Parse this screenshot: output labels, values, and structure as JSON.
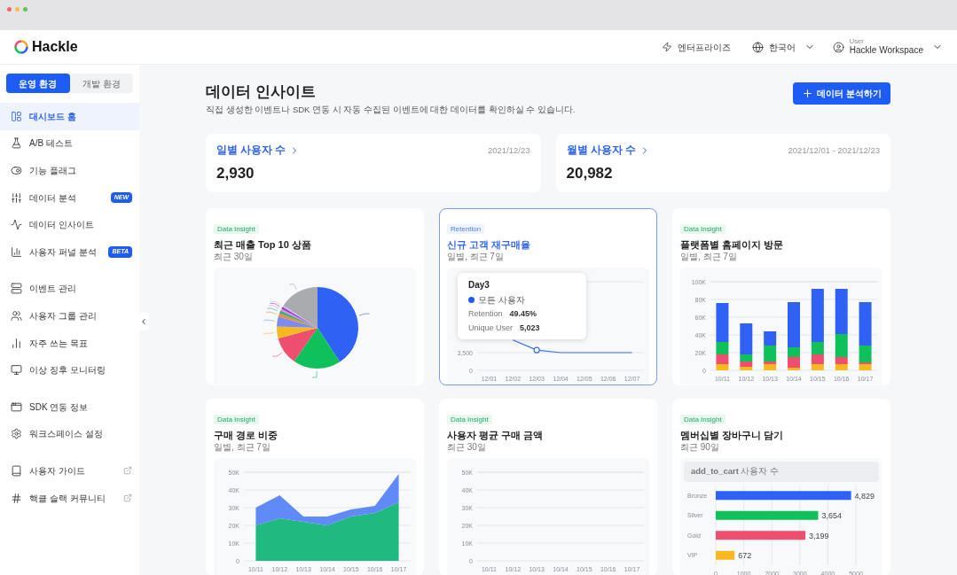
{
  "header": {
    "logo": "Hackle",
    "links": [
      {
        "label": "엔터프라이즈",
        "dropdown": false
      },
      {
        "label": "한국어",
        "dropdown": true
      }
    ],
    "user": {
      "caption": "User",
      "workspace": "Hackle Workspace"
    }
  },
  "env_tabs": [
    {
      "label": "운영 환경",
      "selected": true
    },
    {
      "label": "개발 환경",
      "selected": false
    }
  ],
  "sidebar": {
    "groups": [
      [
        {
          "label": "대시보드 홈",
          "selected": true,
          "external": false
        },
        {
          "label": "A/B 테스트",
          "selected": false,
          "external": false
        },
        {
          "label": "기능 플래그",
          "selected": false,
          "external": false
        },
        {
          "label": "데이터 분석",
          "selected": false,
          "external": false,
          "badge": "NEW"
        },
        {
          "label": "데이터 인사이트",
          "selected": false,
          "external": false
        },
        {
          "label": "사용자 퍼널 분석",
          "selected": false,
          "external": false,
          "badge": "BETA"
        }
      ],
      [
        {
          "label": "이벤트 관리",
          "selected": false,
          "external": false
        },
        {
          "label": "사용자 그룹 관리",
          "selected": false,
          "external": false
        },
        {
          "label": "자주 쓰는 목표",
          "selected": false,
          "external": false
        },
        {
          "label": "이상 징후 모니터링",
          "selected": false,
          "external": false
        }
      ],
      [
        {
          "label": "SDK 연동 정보",
          "selected": false,
          "external": false
        },
        {
          "label": "워크스페이스 설정",
          "selected": false,
          "external": false
        }
      ],
      [
        {
          "label": "사용자 가이드",
          "selected": false,
          "external": true
        },
        {
          "label": "핵클 슬랙 커뮤니티",
          "selected": false,
          "external": true
        }
      ]
    ]
  },
  "page": {
    "title": "데이터 인사이트",
    "subtitle": "직접 생성한 이벤트나 SDK 연동 시 자동 수집된 이벤트에 대한 데이터를 확인하실 수 있습니다.",
    "action": "데이터 분석하기"
  },
  "stats": [
    {
      "label": "일별 사용자 수",
      "date": "2021/12/23",
      "value": "2,930"
    },
    {
      "label": "월별 사용자 수",
      "date": "2021/12/01 - 2021/12/23",
      "value": "20,982"
    }
  ],
  "cards": [
    {
      "kind": "pie",
      "tag": "Data Insight",
      "title": "최근 매출 Top 10 상품",
      "subtitle": "최근 30일",
      "selected": false
    },
    {
      "kind": "retention",
      "tag": "Retention",
      "title": "신규 고객 재구매율",
      "subtitle": "일별, 최근 7일",
      "selected": true,
      "tooltip": {
        "title": "Day3",
        "series": "모든 사용자",
        "rows": [
          {
            "label": "Retention",
            "value": "49.45%"
          },
          {
            "label": "Unique User",
            "value": "5,023"
          }
        ]
      },
      "chart_data": {
        "type": "line",
        "grid": true,
        "categories": [
          "12/01",
          "12/02",
          "12/03",
          "12/04",
          "12/05",
          "12/06",
          "12/07"
        ],
        "ylim": [
          0,
          17500
        ],
        "yticks": [
          0,
          {
            "value": 3500,
            "label": "3,500"
          }
        ],
        "series": [
          {
            "color": "#3b6ef5",
            "values": [
              null,
              6000,
              4000,
              3500,
              3500,
              3500,
              3500
            ]
          }
        ]
      }
    },
    {
      "kind": "vbar",
      "tag": "Data Insight",
      "title": "플랫폼별 홈페이지 방문",
      "subtitle": "일별, 최근 7일",
      "selected": false,
      "chart_data": {
        "type": "bar",
        "stacked": true,
        "grid": true,
        "categories": [
          "10/11",
          "10/12",
          "10/13",
          "10/14",
          "10/15",
          "10/16",
          "10/17"
        ],
        "ylim": [
          0,
          100000
        ],
        "yticks": [
          {
            "value": 0,
            "label": "0"
          },
          {
            "value": 20000,
            "label": "20K"
          },
          {
            "value": 40000,
            "label": "40K"
          },
          {
            "value": 60000,
            "label": "60K"
          },
          {
            "value": 80000,
            "label": "80K"
          },
          {
            "value": 100000,
            "label": "100K"
          }
        ],
        "series": [
          {
            "color": "#f8b820",
            "values": [
              7000,
              4000,
              7000,
              3000,
              7000,
              7000,
              7000
            ]
          },
          {
            "color": "#ef4f6f",
            "values": [
              11000,
              6000,
              3000,
              12000,
              11000,
              8000,
              2000
            ]
          },
          {
            "color": "#0fc15a",
            "values": [
              14000,
              8000,
              18000,
              11000,
              14000,
              26000,
              19000
            ]
          },
          {
            "color": "#2f62f4",
            "values": [
              44000,
              35000,
              16000,
              51000,
              60000,
              51000,
              49000
            ]
          }
        ]
      }
    },
    {
      "kind": "area",
      "tag": "Data Insight",
      "title": "구매 경로 비중",
      "subtitle": "일별, 최근 7일",
      "selected": false,
      "chart_data": {
        "type": "area",
        "stacked": true,
        "grid": true,
        "categories": [
          "10/11",
          "10/12",
          "10/13",
          "10/14",
          "10/15",
          "10/16",
          "10/17"
        ],
        "ylim": [
          0,
          50000
        ],
        "yticks": [
          {
            "value": 0,
            "label": "0"
          },
          {
            "value": 10000,
            "label": "10K"
          },
          {
            "value": 20000,
            "label": "20K"
          },
          {
            "value": 30000,
            "label": "30K"
          },
          {
            "value": 40000,
            "label": "40K"
          },
          {
            "value": 50000,
            "label": "50K"
          }
        ],
        "series": [
          {
            "color": "#20b97f",
            "values": [
              20000,
              24000,
              22000,
              20000,
              25000,
              27000,
              33000
            ]
          },
          {
            "color": "#5f8af7",
            "values": [
              10000,
              13000,
              3000,
              5000,
              4000,
              4000,
              16000
            ]
          }
        ]
      }
    },
    {
      "kind": "empty",
      "tag": "Data Insight",
      "title": "사용자 평균 구매 금액",
      "subtitle": "최근 30일",
      "selected": false,
      "chart_data": {
        "type": "line",
        "grid": true,
        "categories": [
          "10/11",
          "10/12",
          "10/13",
          "10/14",
          "10/15",
          "10/16",
          "10/17"
        ],
        "ylim": [
          0,
          50000
        ],
        "yticks": [
          {
            "value": 0,
            "label": "0"
          },
          {
            "value": 10000,
            "label": "10K"
          },
          {
            "value": 20000,
            "label": "20K"
          },
          {
            "value": 30000,
            "label": "30K"
          },
          {
            "value": 40000,
            "label": "40K"
          },
          {
            "value": 50000,
            "label": "50K"
          }
        ]
      }
    },
    {
      "kind": "hbar",
      "tag": "Data Insight",
      "title": "멤버십별 장바구니 담기",
      "subtitle": "최근 90일",
      "selected": false,
      "chart_data": {
        "type": "bar",
        "title": "**add_to_cart** 사용자 수",
        "orientation": "horizontal",
        "grid": true,
        "categories": [
          "Bronze",
          "Silver",
          "Gold",
          "VIP"
        ],
        "xlim": [
          0,
          5000
        ],
        "xticks": [
          0,
          1000,
          2000,
          3000,
          4000,
          5000
        ],
        "value_labels": [
          "4,829",
          "3,654",
          "3,199",
          "672"
        ],
        "series": [
          {
            "color": "#2f62f4",
            "values": [
              4829,
              null,
              null,
              null
            ]
          },
          {
            "color": "#0fc15a",
            "values": [
              null,
              3654,
              null,
              null
            ]
          },
          {
            "color": "#ef4f6f",
            "values": [
              null,
              null,
              3199,
              null
            ]
          },
          {
            "color": "#f8b820",
            "values": [
              null,
              null,
              null,
              672
            ]
          }
        ]
      }
    }
  ]
}
